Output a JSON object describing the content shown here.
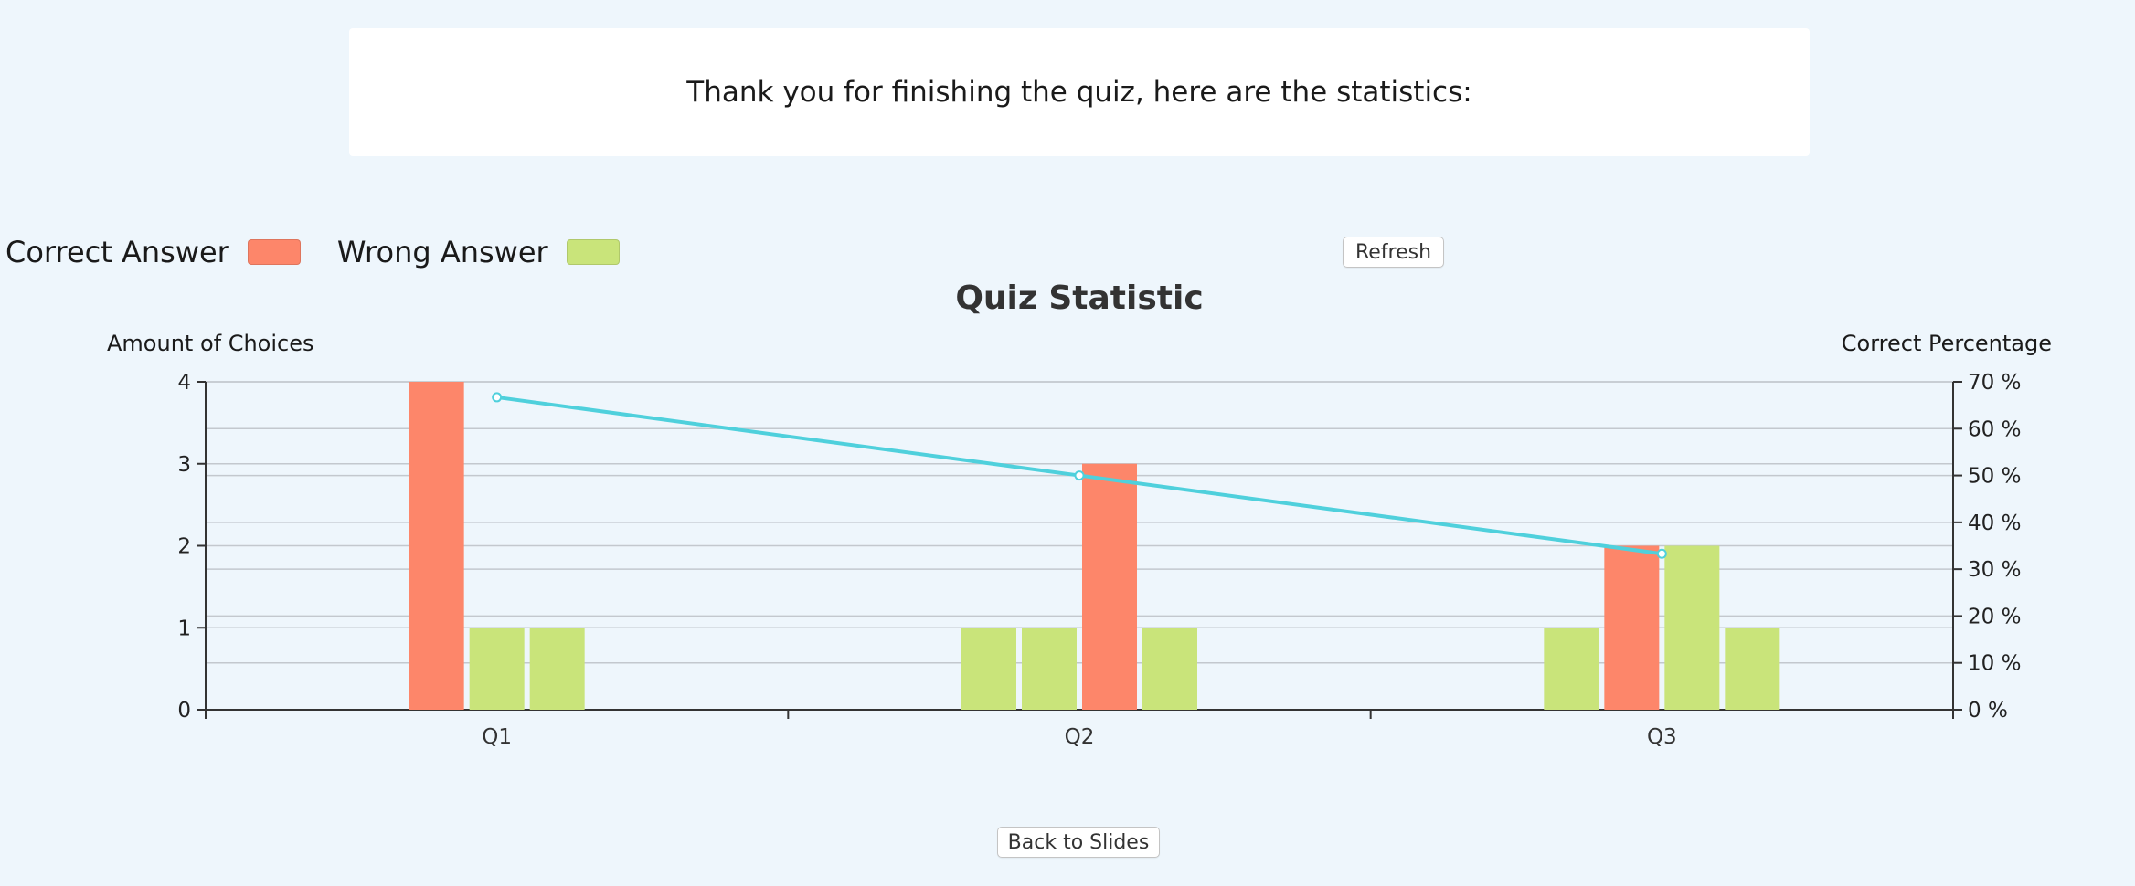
{
  "header": {
    "message": "Thank you for finishing the quiz, here are the statistics:"
  },
  "legend": {
    "correct_label": "Correct Answer",
    "wrong_label": "Wrong Answer",
    "correct_color": "#fd866a",
    "wrong_color": "#c9e47a"
  },
  "buttons": {
    "refresh": "Refresh",
    "back": "Back to Slides"
  },
  "chart_data": {
    "type": "bar",
    "title": "Quiz Statistic",
    "ylabel": "Amount of Choices",
    "ylabel_right": "Correct Percentage",
    "categories": [
      "Q1",
      "Q2",
      "Q3"
    ],
    "ylim": [
      0,
      4
    ],
    "yticks": [
      "0",
      "1",
      "2",
      "3",
      "4"
    ],
    "ylim_right": [
      0,
      70
    ],
    "yticks_right": [
      "0 %",
      "10 %",
      "20 %",
      "30 %",
      "40 %",
      "50 %",
      "60 %",
      "70 %"
    ],
    "grid": true,
    "choices": [
      [
        {
          "value": 4,
          "correct": true
        },
        {
          "value": 1,
          "correct": false
        },
        {
          "value": 1,
          "correct": false
        }
      ],
      [
        {
          "value": 1,
          "correct": false
        },
        {
          "value": 1,
          "correct": false
        },
        {
          "value": 3,
          "correct": true
        },
        {
          "value": 1,
          "correct": false
        }
      ],
      [
        {
          "value": 1,
          "correct": false
        },
        {
          "value": 2,
          "correct": true
        },
        {
          "value": 2,
          "correct": false
        },
        {
          "value": 1,
          "correct": false
        }
      ]
    ],
    "line_series": {
      "values": [
        66.7,
        50.0,
        33.3
      ],
      "color": "#4fd0dc"
    }
  }
}
